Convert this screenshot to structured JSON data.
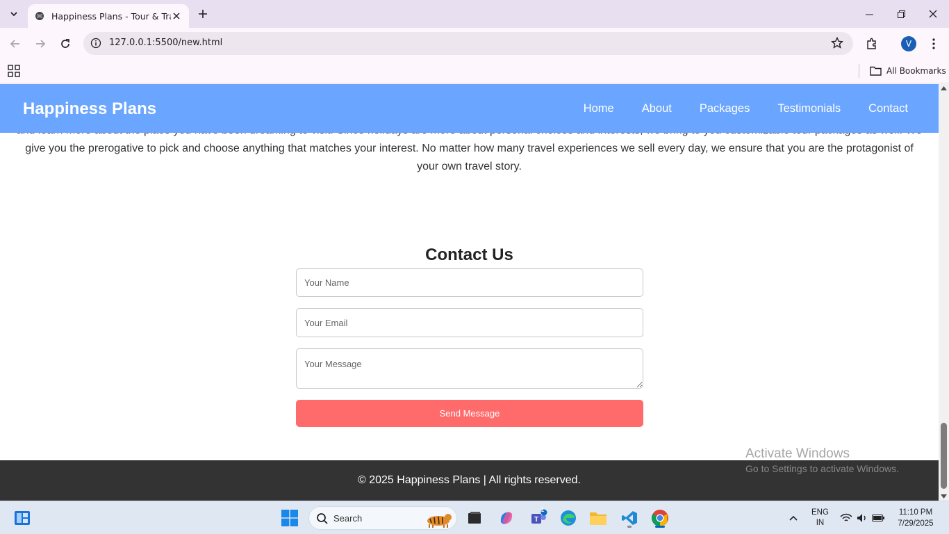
{
  "browser": {
    "tab_title": "Happiness Plans - Tour & Travel",
    "url": "127.0.0.1:5500/new.html",
    "profile_initial": "V",
    "all_bookmarks": "All Bookmarks"
  },
  "site": {
    "logo": "Happiness Plans",
    "nav": [
      "Home",
      "About",
      "Packages",
      "Testimonials",
      "Contact"
    ],
    "about_partial_line": "and learn more about the place you have been dreaming to visit. Since holidays are more about personal choices and interests, we bring to you customizable tour packages as well.",
    "about_line2": "We give you the prerogative to pick and choose anything that matches your interest. No matter how many travel experiences we sell every day, we ensure that you are the protagonist of your own travel story.",
    "contact": {
      "title": "Contact Us",
      "name_placeholder": "Your Name",
      "email_placeholder": "Your Email",
      "message_placeholder": "Your Message",
      "send_label": "Send Message"
    },
    "footer": "© 2025 Happiness Plans | All rights reserved."
  },
  "watermark": {
    "line1": "Activate Windows",
    "line2": "Go to Settings to activate Windows."
  },
  "taskbar": {
    "search_label": "Search",
    "teams_badge": "1",
    "lang_line1": "ENG",
    "lang_line2": "IN",
    "time": "11:10 PM",
    "date": "7/29/2025"
  },
  "colors": {
    "header_bg": "#6aa5ff",
    "send_button": "#ff6b6b",
    "footer_bg": "#333333"
  }
}
